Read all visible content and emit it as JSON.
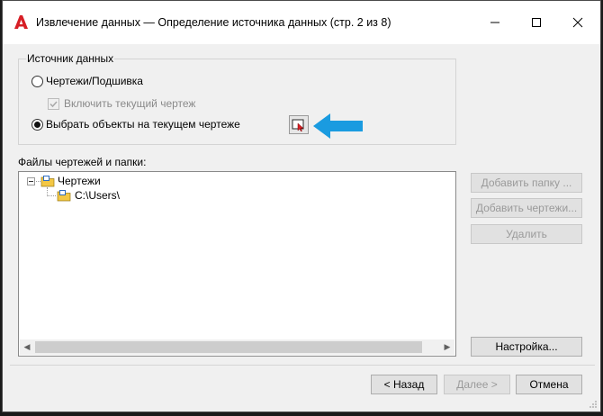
{
  "window": {
    "title": "Извлечение данных — Определение источника данных (стр. 2 из 8)",
    "app_icon": "autocad-a-icon",
    "controls": [
      "minimize-icon",
      "maximize-icon",
      "close-icon"
    ]
  },
  "source_group": {
    "label": "Источник данных",
    "option_drawings": {
      "label": "Чертежи/Подшивка",
      "selected": false
    },
    "include_current": {
      "label": "Включить текущий чертеж",
      "checked": true,
      "enabled": false
    },
    "option_select_objects": {
      "label": "Выбрать объекты на текущем чертеже",
      "selected": true
    },
    "pick_button_icon": "select-objects-icon",
    "annotation_arrow_color": "#1a9be0"
  },
  "files": {
    "label": "Файлы чертежей и папки:",
    "tree": {
      "root": "Чертежи",
      "children": [
        "C:\\Users\\"
      ]
    }
  },
  "side_buttons": {
    "add_folder": "Добавить папку ...",
    "add_drawings": "Добавить чертежи...",
    "remove": "Удалить",
    "settings": "Настройка..."
  },
  "footer": {
    "back": "< Назад",
    "next": "Далее >",
    "cancel": "Отмена"
  }
}
